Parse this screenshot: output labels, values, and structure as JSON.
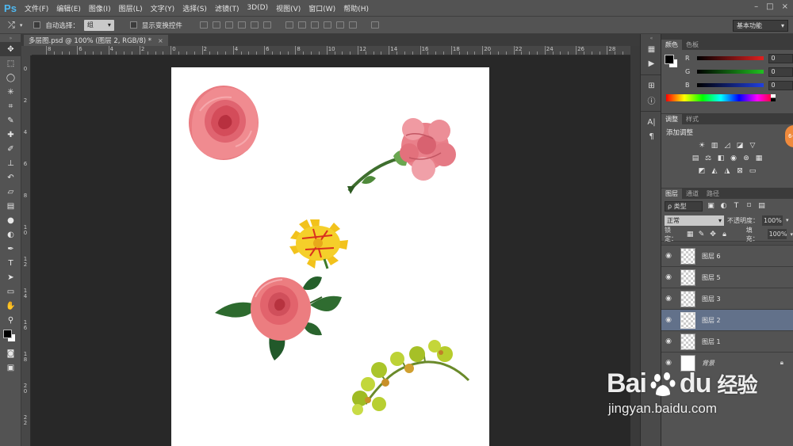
{
  "app": {
    "logo": "Ps"
  },
  "menu": [
    "文件(F)",
    "编辑(E)",
    "图像(I)",
    "图层(L)",
    "文字(Y)",
    "选择(S)",
    "滤镜(T)",
    "3D(D)",
    "视图(V)",
    "窗口(W)",
    "帮助(H)"
  ],
  "window_controls": [
    "–",
    "□",
    "×"
  ],
  "options": {
    "auto_select_label": "自动选择：",
    "auto_select_value": "组",
    "show_transform_label": "显示变换控件",
    "workspace": "基本功能"
  },
  "document": {
    "tab_title": "多层图.psd @ 100% (图层 2, RGB/8) *",
    "close": "×"
  },
  "rulers": {
    "horizontal": [
      "8",
      "6",
      "4",
      "2",
      "0",
      "2",
      "4",
      "6",
      "8",
      "10",
      "12",
      "14",
      "16",
      "18",
      "20",
      "22",
      "24",
      "26",
      "28"
    ],
    "vertical": [
      "0",
      "2",
      "4",
      "6",
      "8",
      "10",
      "12",
      "14",
      "16",
      "18",
      "20",
      "22"
    ]
  },
  "color_panel": {
    "tabs": [
      "颜色",
      "色板"
    ],
    "channels": [
      {
        "label": "R",
        "value": "0",
        "color": "#e02020"
      },
      {
        "label": "G",
        "value": "0",
        "color": "#20c020"
      },
      {
        "label": "B",
        "value": "0",
        "color": "#2040e0"
      }
    ]
  },
  "adjust_panel": {
    "tabs": [
      "调整",
      "样式"
    ],
    "title": "添加调整"
  },
  "layers_panel": {
    "tabs": [
      "图层",
      "通道",
      "路径"
    ],
    "filter_kind": "ρ 类型",
    "blend_mode": "正常",
    "opacity_label": "不透明度：",
    "opacity_value": "100%",
    "lock_label": "锁定：",
    "fill_label": "填充：",
    "fill_value": "100%",
    "layers": [
      {
        "name": "图层 6",
        "selected": false
      },
      {
        "name": "图层 5",
        "selected": false
      },
      {
        "name": "图层 3",
        "selected": false
      },
      {
        "name": "图层 2",
        "selected": true
      },
      {
        "name": "图层 1",
        "selected": false
      },
      {
        "name": "背景",
        "selected": false
      }
    ]
  },
  "badge": {
    "text": "6-"
  },
  "watermark": {
    "brand": "Bai",
    "brand2": "du",
    "cn": "经验",
    "url": "jingyan.baidu.com"
  },
  "colors": {
    "accent_selected": "#62718a",
    "panel_bg": "#535353",
    "canvas_bg": "#282828"
  }
}
